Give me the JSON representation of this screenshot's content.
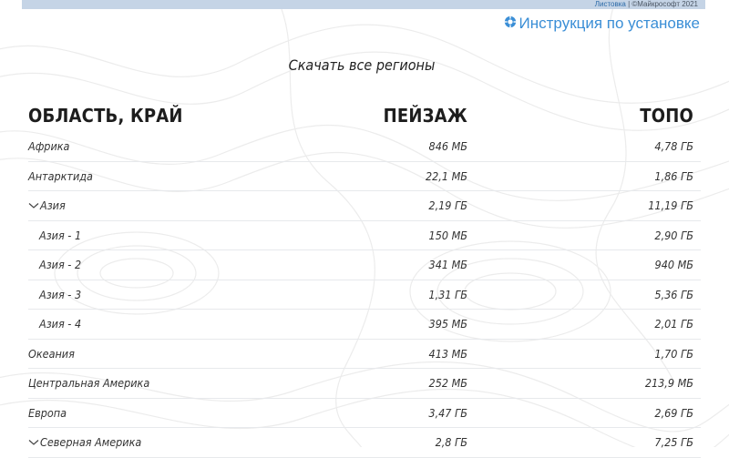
{
  "topbar": {
    "link_label": "Листовка",
    "separator": " | ",
    "copyright": "©Майкрософт 2021"
  },
  "install": {
    "label": "Инструкция по установке",
    "icon": "gear-icon",
    "color": "#3a8ed6"
  },
  "download_all": {
    "label": "Скачать все регионы"
  },
  "table": {
    "headers": {
      "region": "ОБЛАСТЬ, КРАЙ",
      "landscape": "ПЕЙЗАЖ",
      "topo": "ТОПО"
    },
    "rows": [
      {
        "name": "Африка",
        "landscape": "846 МБ",
        "topo": "4,78 ГБ"
      },
      {
        "name": "Антарктида",
        "landscape": "22,1 МБ",
        "topo": "1,86 ГБ"
      },
      {
        "name": "Азия",
        "landscape": "2,19 ГБ",
        "topo": "11,19 ГБ"
      },
      {
        "name": "Азия - 1",
        "landscape": "150 МБ",
        "topo": "2,90 ГБ"
      },
      {
        "name": "Азия - 2",
        "landscape": "341 МБ",
        "topo": "940 МБ"
      },
      {
        "name": "Азия - 3",
        "landscape": "1,31 ГБ",
        "topo": "5,36 ГБ"
      },
      {
        "name": "Азия - 4",
        "landscape": "395 МБ",
        "topo": "2,01 ГБ"
      },
      {
        "name": "Океания",
        "landscape": "413 МБ",
        "topo": "1,70 ГБ"
      },
      {
        "name": "Центральная Америка",
        "landscape": "252 МБ",
        "topo": "213,9 МБ"
      },
      {
        "name": "Европа",
        "landscape": "3,47 ГБ",
        "topo": "2,69 ГБ"
      },
      {
        "name": "Северная Америка",
        "landscape": "2,8 ГБ",
        "topo": "7,25 ГБ"
      }
    ]
  }
}
